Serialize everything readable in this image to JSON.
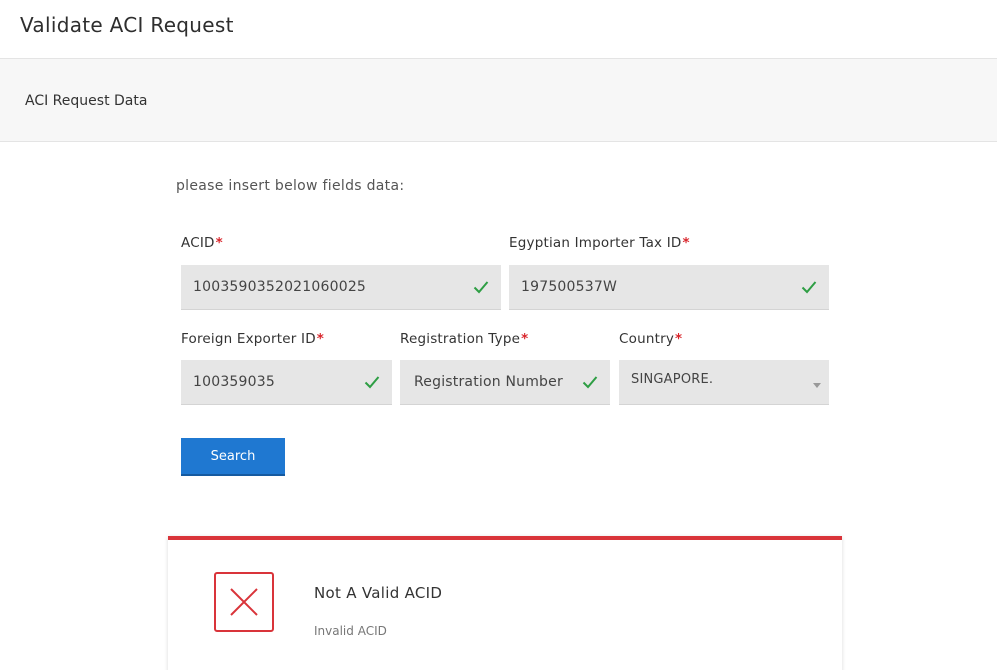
{
  "header": {
    "title": "Validate ACI Request"
  },
  "section": {
    "title": "ACI Request Data"
  },
  "form": {
    "intro": "please insert below fields data:",
    "acid": {
      "label": "ACID",
      "value": "1003590352021060025",
      "valid": true
    },
    "importer_tax_id": {
      "label": "Egyptian Importer Tax ID",
      "value": "197500537W",
      "valid": true
    },
    "foreign_exporter_id": {
      "label": "Foreign Exporter ID",
      "value": "100359035",
      "valid": true
    },
    "registration_type": {
      "label": "Registration Type",
      "value": "Registration Number",
      "valid": true
    },
    "country": {
      "label": "Country",
      "value": "SINGAPORE."
    },
    "required_marker": "*",
    "search_label": "Search"
  },
  "result": {
    "status": "error",
    "title": "Not A Valid ACID",
    "message": "Invalid ACID"
  },
  "colors": {
    "primary": "#1f78d1",
    "error": "#d9343a",
    "success": "#2e9e44",
    "field_bg": "#e6e6e6"
  }
}
